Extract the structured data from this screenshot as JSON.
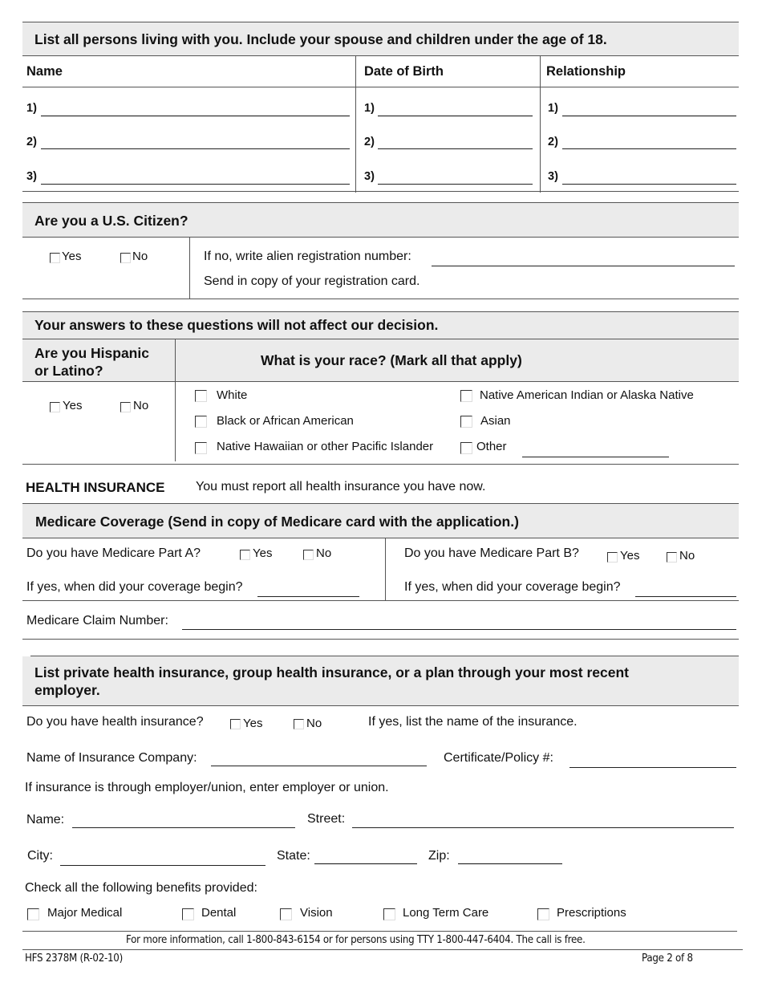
{
  "household": {
    "title": "List all persons living with you.  Include your spouse and children under the age of 18.",
    "columns": [
      "Name",
      "Date of Birth",
      "Relationship"
    ],
    "row_numbers": [
      "1)",
      "2)",
      "3)"
    ],
    "rows": [
      {
        "name": "",
        "dob": "",
        "relationship": ""
      },
      {
        "name": "",
        "dob": "",
        "relationship": ""
      },
      {
        "name": "",
        "dob": "",
        "relationship": ""
      }
    ]
  },
  "citizenship": {
    "title": "Are you a U.S. Citizen?",
    "yes_label": "Yes",
    "no_label": "No",
    "yes_checked": false,
    "no_checked": false,
    "alien_reg_label": "If no, write alien registration number:",
    "alien_reg_value": "",
    "note": "Send in copy of your registration card."
  },
  "ethnicity": {
    "title": "Your answers to these questions will not affect our decision.",
    "hispanic_question": "Are you Hispanic or Latino?",
    "hispanic_line1": "Are you Hispanic",
    "hispanic_line2": "or Latino?",
    "yes_label": "Yes",
    "no_label": "No",
    "race_question": "What is your race? (Mark all that apply)",
    "race_options": [
      {
        "label": "White",
        "checked": false
      },
      {
        "label": "Black or African American",
        "checked": false
      },
      {
        "label": "Native Hawaiian or other Pacific Islander",
        "checked": false
      },
      {
        "label": "Native American Indian or Alaska Native",
        "checked": false
      },
      {
        "label": "Asian",
        "checked": false
      },
      {
        "label": "Other",
        "checked": false
      }
    ],
    "other_value": ""
  },
  "health_insurance": {
    "heading": "HEALTH INSURANCE",
    "subheading": "You must report all health insurance you have now."
  },
  "medicare": {
    "title": "Medicare Coverage (Send in copy of Medicare card with the application.)",
    "part_a_question": "Do you have Medicare Part A?",
    "part_b_question": "Do you have Medicare Part B?",
    "yes_label": "Yes",
    "no_label": "No",
    "coverage_begin_label": "If yes, when did your coverage begin?",
    "part_a_begin": "",
    "part_b_begin": "",
    "claim_number_label": "Medicare Claim Number:",
    "claim_number": ""
  },
  "private_insurance": {
    "title_line1": "List private health insurance, group health insurance, or a plan through your most recent",
    "title_line2": "employer.",
    "have_insurance_question": "Do you have health insurance?",
    "yes_label": "Yes",
    "no_label": "No",
    "list_name_note": "If yes, list the name of the insurance.",
    "company_label": "Name of Insurance Company:",
    "company_value": "",
    "policy_label": "Certificate/Policy #:",
    "policy_value": "",
    "employer_note": "If insurance is through employer/union, enter employer or union.",
    "name_label": "Name:",
    "name_value": "",
    "street_label": "Street:",
    "street_value": "",
    "city_label": "City:",
    "city_value": "",
    "state_label": "State:",
    "state_value": "",
    "zip_label": "Zip:",
    "zip_value": "",
    "benefits_label": "Check all the following benefits provided:",
    "benefits": [
      {
        "label": "Major Medical",
        "checked": false
      },
      {
        "label": "Dental",
        "checked": false
      },
      {
        "label": "Vision",
        "checked": false
      },
      {
        "label": "Long Term Care",
        "checked": false
      },
      {
        "label": "Prescriptions",
        "checked": false
      }
    ]
  },
  "footer": {
    "info": "For more information, call 1-800-843-6154 or for persons using TTY 1-800-447-6404.  The call is free.",
    "form_id": "HFS 2378M (R-02-10)",
    "page": "Page 2 of 8"
  }
}
